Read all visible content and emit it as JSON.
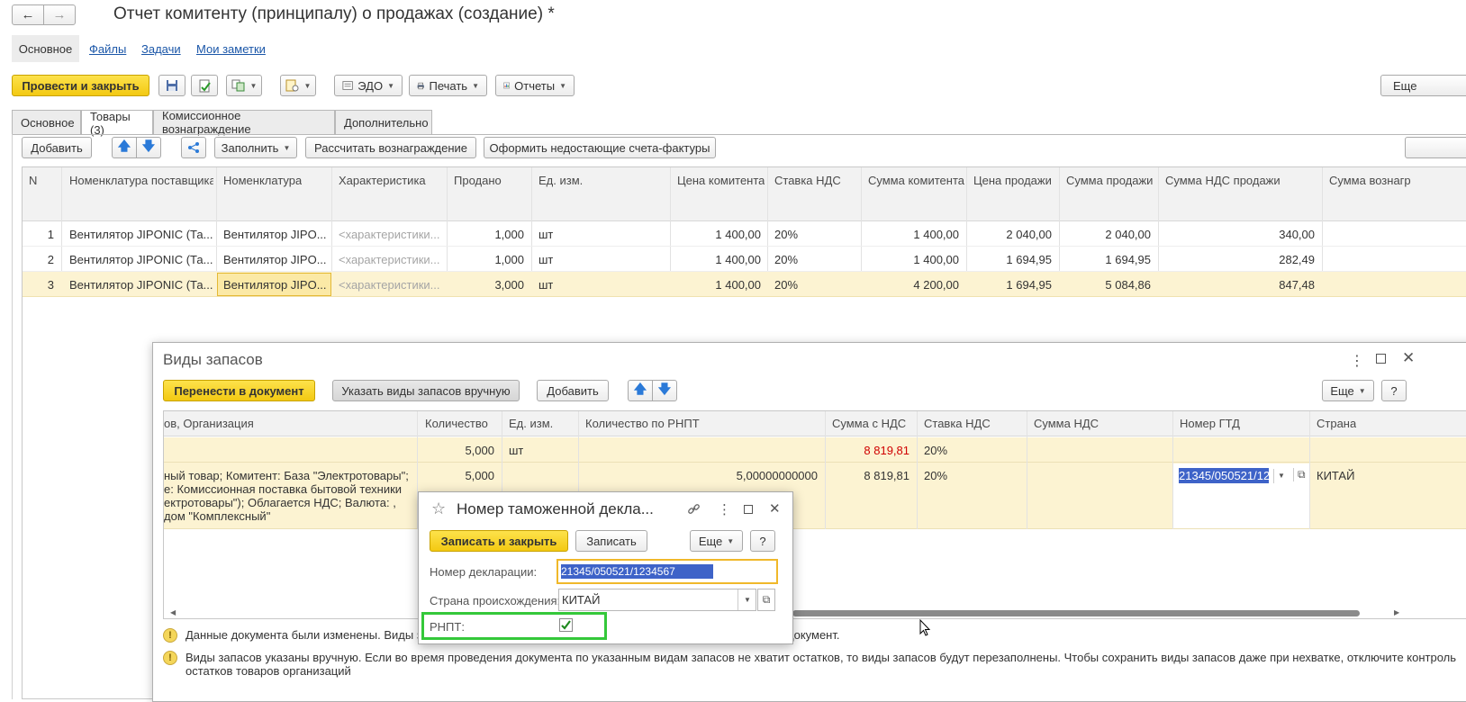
{
  "window": {
    "title": "Отчет комитенту (принципалу) о продажах (создание) *"
  },
  "nav_tabs": [
    {
      "label": "Основное"
    },
    {
      "label": "Файлы"
    },
    {
      "label": "Задачи"
    },
    {
      "label": "Мои заметки"
    }
  ],
  "toolbar": {
    "post_close": "Провести и закрыть",
    "edo": "ЭДО",
    "print": "Печать",
    "reports": "Отчеты",
    "more": "Еще"
  },
  "doc_tabs": [
    {
      "label": "Основное"
    },
    {
      "label": "Товары (3)"
    },
    {
      "label": "Комиссионное вознаграждение"
    },
    {
      "label": "Дополнительно"
    }
  ],
  "goods_toolbar": {
    "add": "Добавить",
    "fill": "Заполнить",
    "calc_reward": "Рассчитать вознаграждение",
    "make_invoices": "Оформить недостающие счета-фактуры"
  },
  "goods_table": {
    "headers": [
      "N",
      "Номенклатура поставщика",
      "Номенклатура",
      "Характеристика",
      "Продано",
      "Ед. изм.",
      "Цена комитента",
      "Ставка НДС",
      "Сумма комитента",
      "Цена продажи",
      "Сумма продажи",
      "Сумма НДС продажи",
      "Сумма вознагр"
    ],
    "rows": [
      [
        "1",
        "Вентилятор JIPONIC (Та...",
        "Вентилятор JIPO...",
        "<характеристики...",
        "1,000",
        "шт",
        "1 400,00",
        "20%",
        "1 400,00",
        "2 040,00",
        "2 040,00",
        "340,00"
      ],
      [
        "2",
        "Вентилятор JIPONIC (Та...",
        "Вентилятор JIPO...",
        "<характеристики...",
        "1,000",
        "шт",
        "1 400,00",
        "20%",
        "1 400,00",
        "1 694,95",
        "1 694,95",
        "282,49"
      ],
      [
        "3",
        "Вентилятор JIPONIC (Та...",
        "Вентилятор JIPO...",
        "<характеристики...",
        "3,000",
        "шт",
        "1 400,00",
        "20%",
        "4 200,00",
        "1 694,95",
        "5 084,86",
        "847,48"
      ]
    ]
  },
  "stock_types_dialog": {
    "title": "Виды запасов",
    "transfer": "Перенести в документ",
    "manual": "Указать виды запасов вручную",
    "add": "Добавить",
    "more": "Еще",
    "help": "?",
    "headers": [
      "ов, Организация",
      "Количество",
      "Ед. изм.",
      "Количество по РНПТ",
      "Сумма с НДС",
      "Ставка НДС",
      "Сумма НДС",
      "Номер ГТД",
      "Страна"
    ],
    "group_row": {
      "qty": "5,000",
      "unit": "шт",
      "sum": "8 819,81",
      "rate": "20%"
    },
    "detail_row": {
      "desc_lines": [
        "ный товар; Комитент: База \"Электротовары\";",
        "е: Комиссионная поставка бытовой техники",
        "ектротовары\"); Облагается НДС; Валюта: ,",
        "дом \"Комплексный\""
      ],
      "qty": "5,000",
      "qty_rnpt": "5,00000000000",
      "sum": "8 819,81",
      "rate": "20%",
      "gtd": "21345/050521/12",
      "country": "КИТАЙ"
    },
    "messages": [
      {
        "text_left": "Данные документа были изменены. Виды за",
        "text_right": "документ."
      },
      {
        "text_line1": "Виды запасов указаны вручную. Если во время проведения документа по указанным видам запасов не хватит остатков, то виды запасов будут перезаполнены. Чтобы сохранить виды запасов даже при нехватке, отключите контроль",
        "text_line2": "остатков товаров организаций"
      }
    ]
  },
  "customs_dialog": {
    "title": "Номер таможенной декла...",
    "save_close": "Записать и закрыть",
    "save": "Записать",
    "more": "Еще",
    "help": "?",
    "decl_label": "Номер декларации:",
    "decl_value": "21345/050521/1234567",
    "country_label": "Страна происхождения:",
    "country_value": "КИТАЙ",
    "rnpt_label": "РНПТ:",
    "rnpt_checked": true
  },
  "colors": {
    "accent_yellow": "#f5cd1a",
    "selected_row": "#fcf3d2",
    "highlight_green": "#34c83a",
    "selection_blue": "#3e63c8"
  }
}
